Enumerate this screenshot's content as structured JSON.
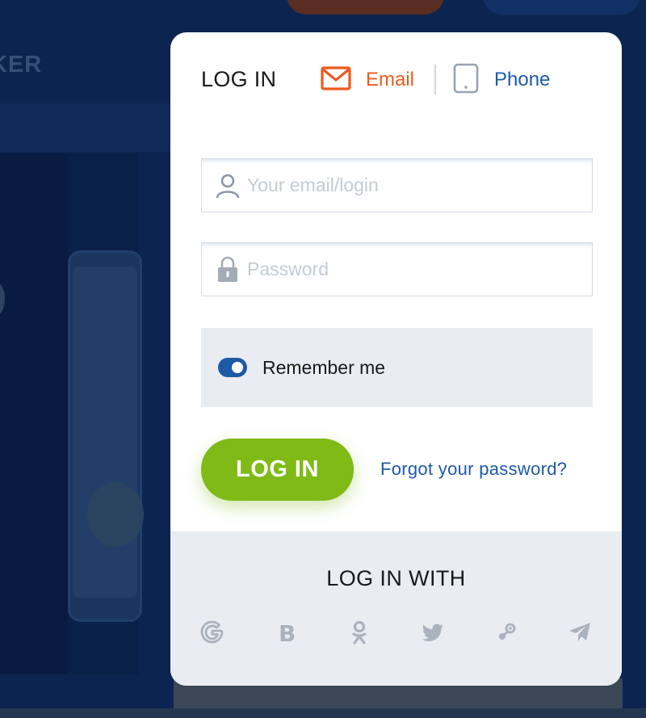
{
  "background": {
    "brand_fragment": "KER"
  },
  "login": {
    "title": "LOG IN",
    "tabs": [
      {
        "label": "Email",
        "icon": "envelope-icon",
        "color": "#ee5a1d",
        "active": true
      },
      {
        "label": "Phone",
        "icon": "mobile-phone-icon",
        "color": "#1d5aa6",
        "active": false
      }
    ],
    "email_placeholder": "Your email/login",
    "password_placeholder": "Password",
    "remember_label": "Remember me",
    "remember_checked": true,
    "submit_label": "LOG IN",
    "forgot_label": "Forgot your password?",
    "accent_color": "#80ba16"
  },
  "social": {
    "title": "LOG IN WITH",
    "providers": [
      "google-icon",
      "b-icon",
      "odnoklassniki-icon",
      "twitter-icon",
      "steam-icon",
      "telegram-icon"
    ]
  }
}
